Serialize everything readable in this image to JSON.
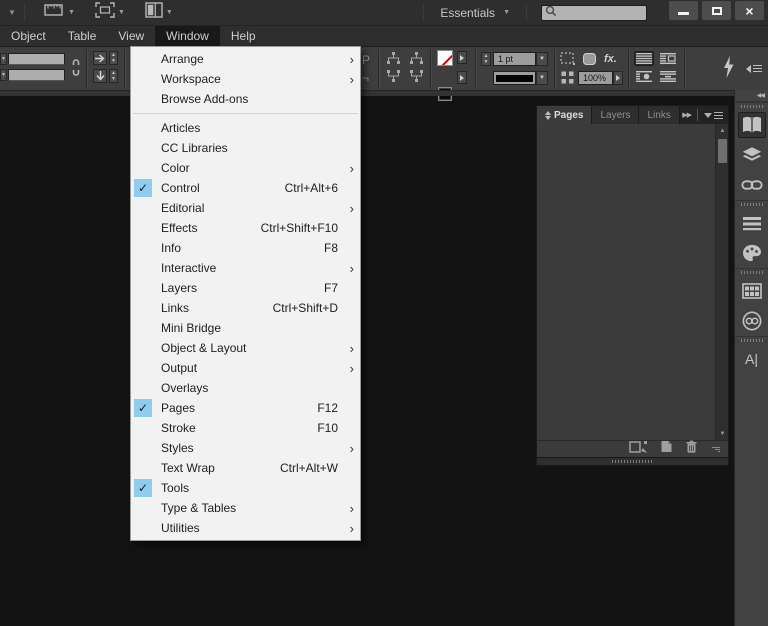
{
  "colors": {
    "titlebar_bg": "#2e2e2e",
    "panel_bg": "#3e3e3e",
    "canvas_bg": "#131313",
    "menu_popup_bg": "#f2f2f2",
    "check_highlight_blue": "#8ecdf0",
    "none_swatch_red": "#d40000",
    "field_gray": "#9d9d9d"
  },
  "app_bar": {
    "icons": [
      "dropdown-arrow-icon",
      "view-options-icon",
      "screen-mode-icon",
      "arrange-documents-icon"
    ],
    "workspace": {
      "label": "Essentials"
    },
    "search": {
      "value": ""
    },
    "window_controls": [
      "minimize",
      "maximize",
      "close"
    ]
  },
  "menu_bar": {
    "items": [
      {
        "label": "Object"
      },
      {
        "label": "Table"
      },
      {
        "label": "View"
      },
      {
        "label": "Window",
        "active": true
      },
      {
        "label": "Help"
      }
    ]
  },
  "window_menu": {
    "items": [
      {
        "label": "Arrange",
        "submenu": true
      },
      {
        "label": "Workspace",
        "submenu": true
      },
      {
        "label": "Browse Add-ons"
      },
      {
        "separator": true
      },
      {
        "label": "Articles"
      },
      {
        "label": "CC Libraries"
      },
      {
        "label": "Color",
        "submenu": true
      },
      {
        "label": "Control",
        "checked": true,
        "shortcut": "Ctrl+Alt+6"
      },
      {
        "label": "Editorial",
        "submenu": true
      },
      {
        "label": "Effects",
        "shortcut": "Ctrl+Shift+F10"
      },
      {
        "label": "Info",
        "shortcut": "F8"
      },
      {
        "label": "Interactive",
        "submenu": true
      },
      {
        "label": "Layers",
        "shortcut": "F7"
      },
      {
        "label": "Links",
        "shortcut": "Ctrl+Shift+D"
      },
      {
        "label": "Mini Bridge"
      },
      {
        "label": "Object & Layout",
        "submenu": true
      },
      {
        "label": "Output",
        "submenu": true
      },
      {
        "label": "Overlays"
      },
      {
        "label": "Pages",
        "checked": true,
        "shortcut": "F12"
      },
      {
        "label": "Stroke",
        "shortcut": "F10"
      },
      {
        "label": "Styles",
        "submenu": true
      },
      {
        "label": "Text Wrap",
        "shortcut": "Ctrl+Alt+W"
      },
      {
        "label": "Tools",
        "checked": true
      },
      {
        "label": "Type & Tables",
        "submenu": true
      },
      {
        "label": "Utilities",
        "submenu": true
      }
    ]
  },
  "control_panel": {
    "stroke_weight": "1 pt",
    "opacity": "100%",
    "fx_label": "fx.",
    "flip_indicator": "P",
    "icons": [
      "link-chain-icon",
      "arrow-right-boxed-icon",
      "arrow-down-boxed-icon",
      "fill-none-swatch",
      "stroke-swatch",
      "corner-options-icon",
      "drop-shadow-icon",
      "effects-fx-icon",
      "scale-icon",
      "wrap-none-icon",
      "wrap-bounding-box-icon",
      "wrap-object-icon",
      "wrap-jump-icon",
      "quick-apply-lightning-icon",
      "panel-menu-icon"
    ]
  },
  "pages_panel": {
    "tabs": [
      {
        "label": "Pages",
        "active": true
      },
      {
        "label": "Layers"
      },
      {
        "label": "Links"
      }
    ],
    "bottom_icons": [
      "edit-page-size-icon",
      "new-page-icon",
      "delete-page-trash-icon"
    ]
  },
  "dock": {
    "items": [
      {
        "grip": true
      },
      {
        "name": "pages-icon",
        "active": true
      },
      {
        "name": "layers-icon"
      },
      {
        "name": "links-icon"
      },
      {
        "grip": true
      },
      {
        "name": "stroke-icon"
      },
      {
        "name": "color-icon"
      },
      {
        "grip": true
      },
      {
        "name": "swatches-icon"
      },
      {
        "name": "cc-libraries-icon"
      },
      {
        "grip": true
      },
      {
        "name": "character-icon"
      }
    ]
  }
}
